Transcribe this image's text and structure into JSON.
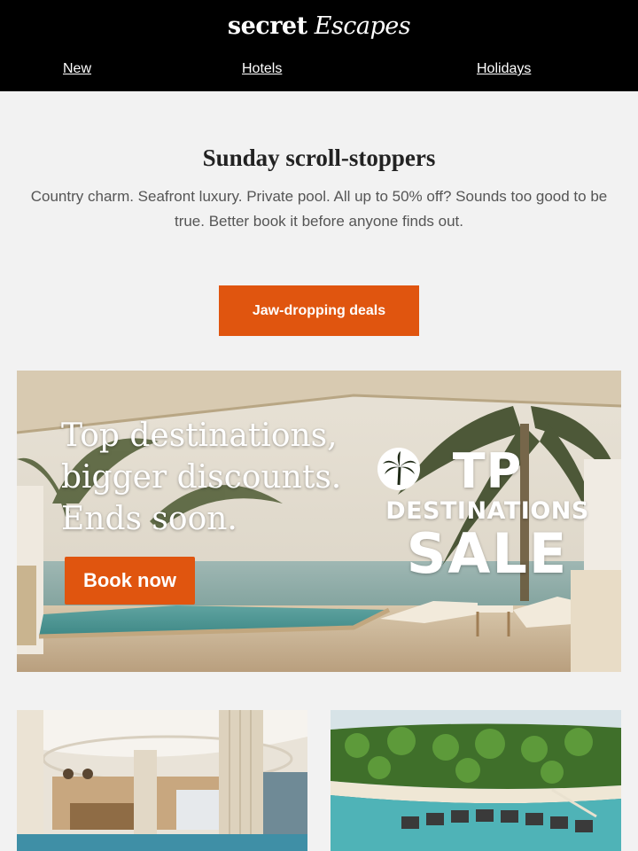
{
  "brand": {
    "logo_part1": "secret",
    "logo_part2": "Escapes"
  },
  "nav": {
    "items": [
      {
        "label": "New"
      },
      {
        "label": "Hotels"
      },
      {
        "label": "Holidays"
      }
    ]
  },
  "main": {
    "headline": "Sunday scroll-stoppers",
    "intro": "Country charm. Seafront luxury. Private pool. All up to 50% off? Sounds too good to be true. Better book it before anyone finds out.",
    "cta_label": "Jaw-dropping deals"
  },
  "banner": {
    "headline_lines": [
      "Top destinations,",
      "bigger discounts.",
      "Ends soon."
    ],
    "button_label": "Book now",
    "sale_top_left": "T",
    "sale_top_right": "P",
    "sale_line2": "DESTINATIONS",
    "sale_line3": "SALE",
    "palm_icon": "palm-tree-icon"
  },
  "cards": [
    {
      "image": "hotel-lobby-photo"
    },
    {
      "image": "island-resort-aerial-photo"
    }
  ],
  "colors": {
    "header_bg": "#000000",
    "accent": "#e0550f",
    "page_bg": "#f2f2f2"
  }
}
